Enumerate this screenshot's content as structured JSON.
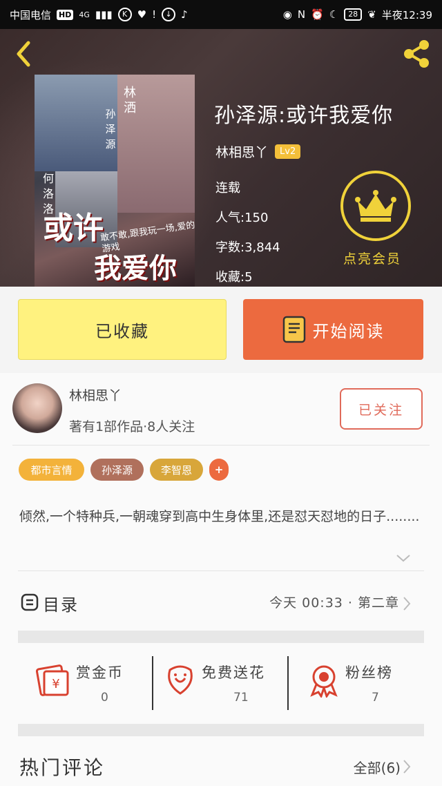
{
  "status_bar": {
    "carrier": "中国电信",
    "network": "HD",
    "signal": "4G",
    "time": "半夜12:39",
    "battery": "28"
  },
  "book": {
    "title": "孙泽源:或许我爱你",
    "author": "林相思丫",
    "level": "Lv2",
    "status": "连载",
    "popularity": "人气:150",
    "word_count": "字数:3,844",
    "favorites": "收藏:5",
    "vip_label": "点亮会员"
  },
  "cover": {
    "title_line1": "或许",
    "title_line2": "我爱你",
    "name_a": "林洒",
    "name_b": "孙泽源",
    "name_c": "何洛洛",
    "tagline": "敢不敢,跟我玩一场,爱的游戏"
  },
  "actions": {
    "collect_label": "已收藏",
    "read_label": "开始阅读"
  },
  "author_card": {
    "name": "林相思丫",
    "info": "著有1部作品·8人关注",
    "follow_label": "已关注"
  },
  "tags": [
    "都市言情",
    "孙泽源",
    "李智恩",
    "+"
  ],
  "description": "  倾然,一个特种兵,一朝魂穿到高中生身体里,还是怼天怼地的日子........",
  "toc": {
    "label": "目录",
    "latest": "今天 00:33 · 第二章"
  },
  "stats": [
    {
      "label": "赏金币",
      "value": "0",
      "icon": "red-envelope-icon"
    },
    {
      "label": "免费送花",
      "value": "71",
      "icon": "flower-icon"
    },
    {
      "label": "粉丝榜",
      "value": "7",
      "icon": "medal-icon"
    }
  ],
  "comments": {
    "label": "热门评论",
    "all": "全部(6)"
  },
  "colors": {
    "accent_orange": "#ec6a3f",
    "collect_yellow": "#fff27f",
    "crown_gold": "#f0d23a",
    "follow_red": "#e06a5a",
    "stat_red": "#d8412f"
  }
}
